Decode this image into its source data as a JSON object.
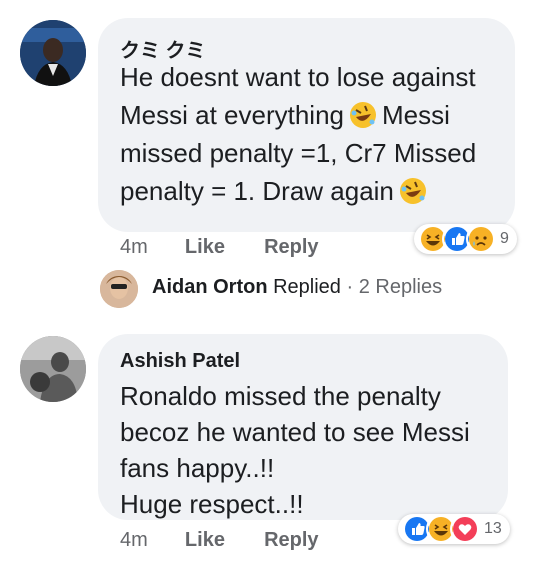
{
  "comments": [
    {
      "author": "クミ クミ",
      "text_lines": [
        "He doesnt want to lose against",
        "Messi at everything",
        "Messi",
        "missed penalty =1, Cr7 Missed",
        "penalty = 1. Draw again"
      ],
      "time": "4m",
      "like_label": "Like",
      "reply_label": "Reply",
      "reactions": [
        "haha",
        "like",
        "sad"
      ],
      "reaction_count": "9",
      "reply_preview": {
        "name": "Aidan Orton",
        "replied": "Replied",
        "dot": "·",
        "count_text": "2 Replies"
      }
    },
    {
      "author": "Ashish Patel",
      "text_lines": [
        "Ronaldo missed the penalty",
        "becoz he wanted to see Messi",
        "fans happy..!!",
        "Huge respect..!!"
      ],
      "time": "4m",
      "like_label": "Like",
      "reply_label": "Reply",
      "reactions": [
        "like",
        "haha",
        "love"
      ],
      "reaction_count": "13"
    }
  ],
  "colors": {
    "bubble": "#f0f2f5",
    "like_blue": "#1877f2",
    "love_red": "#f33e58",
    "haha_yellow": "#f7b125",
    "meta_gray": "#65676b"
  }
}
